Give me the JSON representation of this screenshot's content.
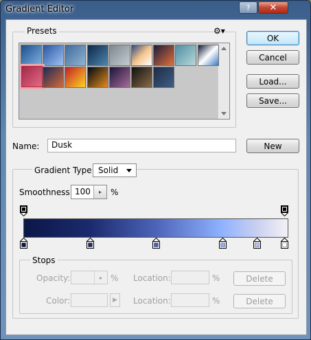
{
  "window": {
    "title": "Gradient Editor",
    "close_glyph": "✕",
    "help_glyph": "?"
  },
  "presets": {
    "label": "Presets",
    "menu_icon": "gear-icon",
    "swatches": [
      {
        "gradient": "linear-gradient(135deg,#1b4f8c,#7fb0df)"
      },
      {
        "gradient": "linear-gradient(135deg,#2a55a5,#9cc2ef)"
      },
      {
        "gradient": "linear-gradient(135deg,#3e6b9e,#93b2cf)"
      },
      {
        "gradient": "linear-gradient(135deg,#0c2848,#4e86b0)"
      },
      {
        "gradient": "linear-gradient(135deg,#7d8890,#c4ccd2)"
      },
      {
        "gradient": "linear-gradient(135deg,#2a4a82,#f4c38b,#ffffff)"
      },
      {
        "gradient": "linear-gradient(135deg,#1b1c3a,#e36f3a)"
      },
      {
        "gradient": "linear-gradient(135deg,#4f8fa0,#b8d8dc)"
      },
      {
        "gradient": "linear-gradient(135deg,#0c1d3a,#ffffff,#3a7bc5)"
      },
      {
        "gradient": "linear-gradient(135deg,#a02848,#e56a86)",
        "selected": true
      },
      {
        "gradient": "linear-gradient(135deg,#1c2a55,#d46a3b)"
      },
      {
        "gradient": "linear-gradient(135deg,#c0202a,#ffd21f)"
      },
      {
        "gradient": "linear-gradient(135deg,#000814,#e58b1c)"
      },
      {
        "gradient": "linear-gradient(135deg,#1b153a,#a86c9a)"
      },
      {
        "gradient": "linear-gradient(135deg,#111,#8a6b47)"
      },
      {
        "gradient": "linear-gradient(135deg,#1e2c45,#3f5f85)"
      }
    ]
  },
  "buttons": {
    "ok": "OK",
    "cancel": "Cancel",
    "load": "Load...",
    "save": "Save...",
    "new": "New",
    "delete1": "Delete",
    "delete2": "Delete"
  },
  "name": {
    "label": "Name:",
    "value": "Dusk"
  },
  "gradient": {
    "type_label": "Gradient Type:",
    "type_value": "Solid",
    "smoothness_label": "Smoothness:",
    "smoothness_value": "100",
    "smoothness_unit": "%",
    "bar_gradient": "linear-gradient(90deg,#0b1747 0%,#1b2a6e 25%,#4c64b8 50%,#8fb2ff 75%,#c8cff0 88%,#f3f1f7 100%)",
    "opacity_stops": [
      0,
      100
    ],
    "color_stops": [
      {
        "pos": 0,
        "color": "#0b1747"
      },
      {
        "pos": 25,
        "color": "#1b2a6e"
      },
      {
        "pos": 50,
        "color": "#4a5fc2"
      },
      {
        "pos": 75,
        "color": "#8fb2ff"
      },
      {
        "pos": 88,
        "color": "#b9c2ef"
      },
      {
        "pos": 100,
        "color": "#ffffff"
      }
    ]
  },
  "stops": {
    "label": "Stops",
    "opacity_label": "Opacity:",
    "opacity_unit": "%",
    "location1_label": "Location:",
    "location1_unit": "%",
    "color_label": "Color:",
    "location2_label": "Location:",
    "location2_unit": "%"
  }
}
